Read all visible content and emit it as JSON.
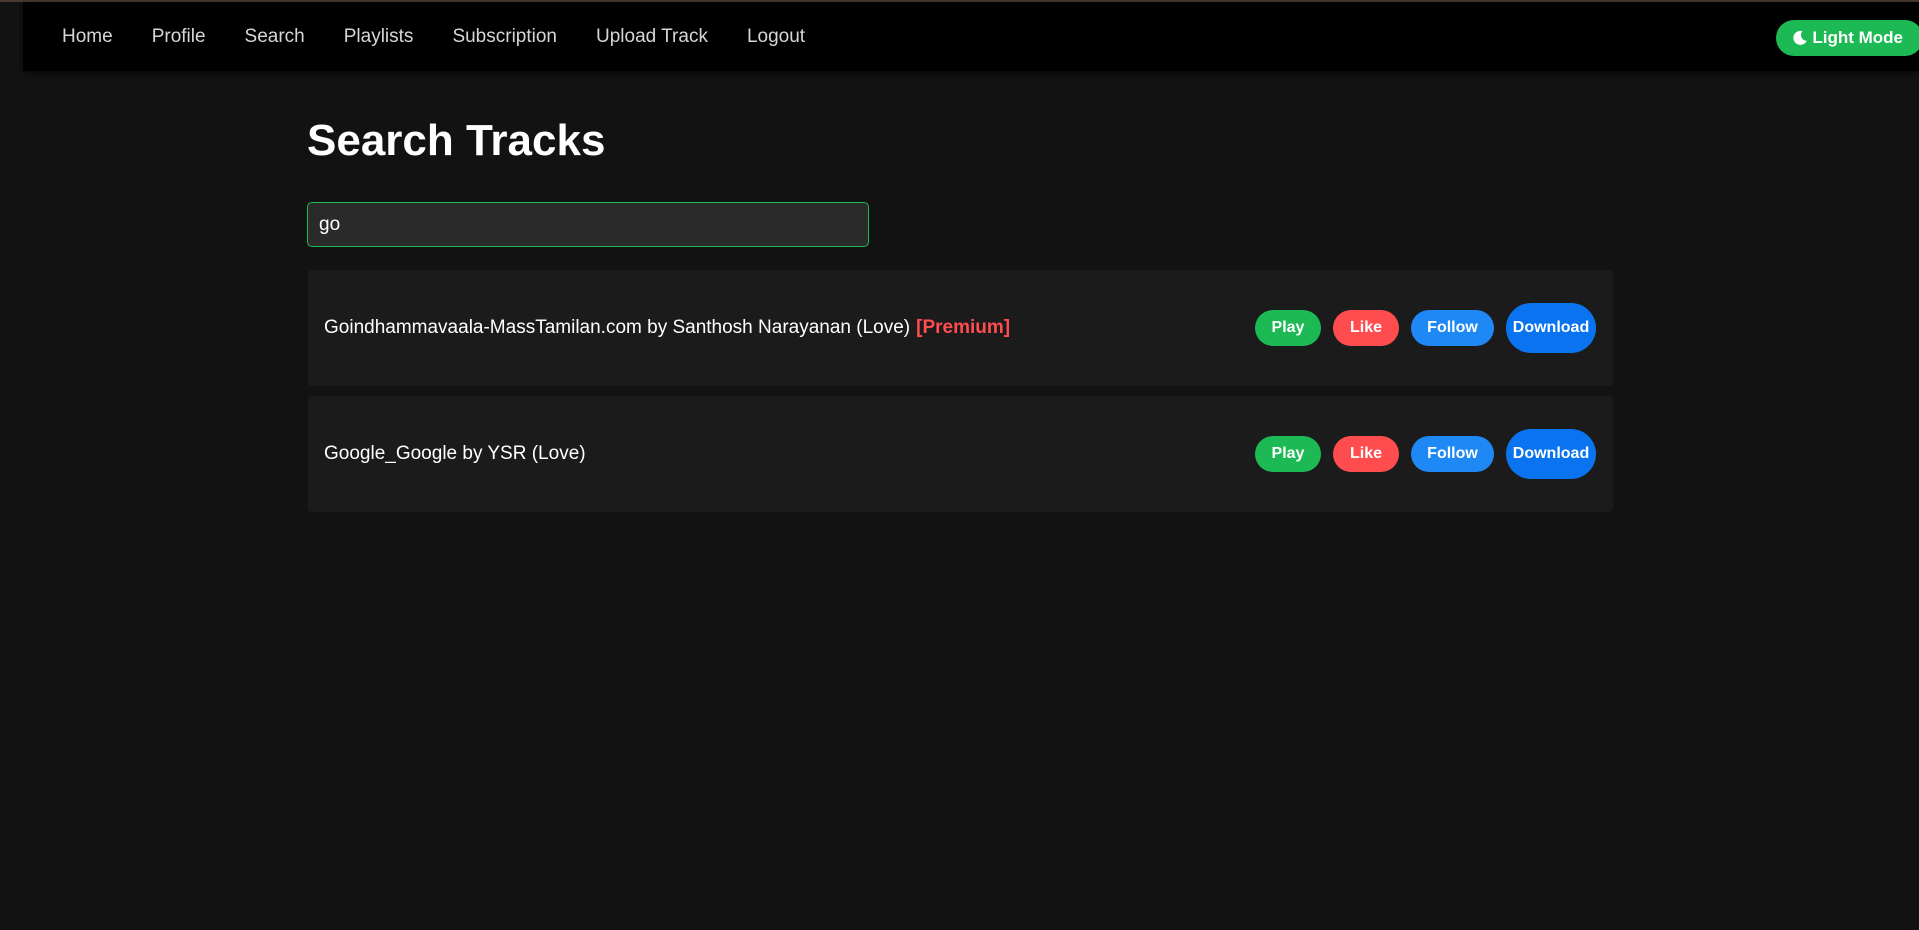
{
  "nav": {
    "links": [
      "Home",
      "Profile",
      "Search",
      "Playlists",
      "Subscription",
      "Upload Track",
      "Logout"
    ],
    "theme_toggle_label": "Light Mode"
  },
  "page": {
    "title": "Search Tracks"
  },
  "search": {
    "value": "go"
  },
  "results": [
    {
      "text": "Goindhammavaala-MassTamilan.com by Santhosh Narayanan (Love)",
      "badge": "[Premium]",
      "actions": {
        "play": "Play",
        "like": "Like",
        "follow": "Follow",
        "download": "Download"
      }
    },
    {
      "text": "Google_Google by YSR (Love)",
      "badge": "",
      "actions": {
        "play": "Play",
        "like": "Like",
        "follow": "Follow",
        "download": "Download"
      }
    }
  ],
  "colors": {
    "background": "#121212",
    "navbar": "#000000",
    "accent_green": "#1db954",
    "like_red": "#ff4d4f",
    "follow_blue": "#1e88f5",
    "download_blue": "#0a74f0",
    "premium_red": "#ff4d4f"
  },
  "icons": {
    "theme_toggle": "moon-icon"
  }
}
